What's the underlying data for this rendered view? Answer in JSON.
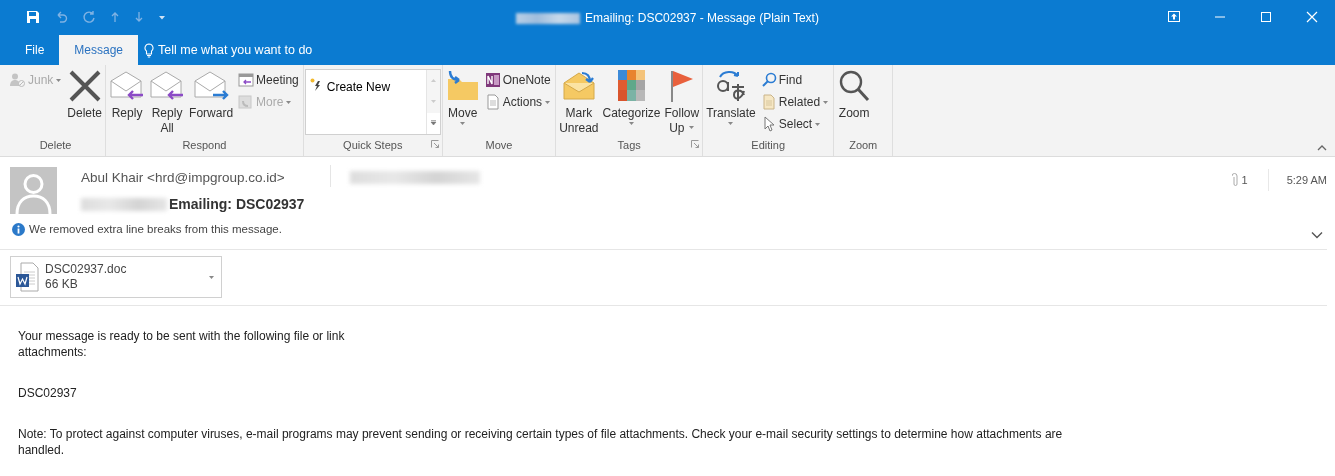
{
  "window": {
    "title": "Emailing: DSC02937 - Message (Plain Text)"
  },
  "tabs": [
    {
      "label": "File",
      "selected": false
    },
    {
      "label": "Message",
      "selected": true
    }
  ],
  "tell_me": {
    "placeholder": "Tell me what you want to do"
  },
  "ribbon": {
    "groups": [
      {
        "label": "Delete",
        "launcher": false,
        "items": [
          {
            "kind": "stack",
            "items": [
              {
                "label": "Junk",
                "disabled": true,
                "dropdown": true
              }
            ]
          },
          {
            "kind": "large",
            "lines": [
              "Delete"
            ],
            "dropdown": false
          }
        ]
      },
      {
        "label": "Respond",
        "launcher": false,
        "items": [
          {
            "kind": "large",
            "lines": [
              "Reply"
            ],
            "dropdown": false
          },
          {
            "kind": "large",
            "lines": [
              "Reply",
              "All"
            ],
            "dropdown": false
          },
          {
            "kind": "large",
            "lines": [
              "Forward"
            ],
            "dropdown": false
          },
          {
            "kind": "stack",
            "items": [
              {
                "label": "Meeting",
                "disabled": false,
                "dropdown": false
              },
              {
                "label": "More",
                "disabled": true,
                "dropdown": true
              }
            ]
          }
        ]
      },
      {
        "label": "Quick Steps",
        "launcher": true,
        "items": [
          {
            "kind": "gallery",
            "entry": "Create New"
          }
        ]
      },
      {
        "label": "Move",
        "launcher": false,
        "items": [
          {
            "kind": "large",
            "lines": [
              "Move"
            ],
            "dropdown": true
          },
          {
            "kind": "stack",
            "items": [
              {
                "label": "OneNote",
                "disabled": false,
                "dropdown": false
              },
              {
                "label": "Actions",
                "disabled": false,
                "dropdown": true
              }
            ]
          }
        ]
      },
      {
        "label": "Tags",
        "launcher": true,
        "items": [
          {
            "kind": "large",
            "lines": [
              "Mark",
              "Unread"
            ],
            "dropdown": false
          },
          {
            "kind": "large",
            "lines": [
              "Categorize"
            ],
            "dropdown": true
          },
          {
            "kind": "large",
            "lines": [
              "Follow",
              "Up"
            ],
            "dropdown": true
          }
        ]
      },
      {
        "label": "Editing",
        "launcher": false,
        "items": [
          {
            "kind": "large",
            "lines": [
              "Translate"
            ],
            "dropdown": true
          },
          {
            "kind": "stack",
            "items": [
              {
                "label": "Find",
                "disabled": false,
                "dropdown": false
              },
              {
                "label": "Related",
                "disabled": false,
                "dropdown": true
              },
              {
                "label": "Select",
                "disabled": false,
                "dropdown": true
              }
            ]
          }
        ]
      },
      {
        "label": "Zoom",
        "launcher": false,
        "items": [
          {
            "kind": "large",
            "lines": [
              "Zoom"
            ],
            "dropdown": false
          }
        ]
      }
    ]
  },
  "message": {
    "sender": "Abul Khair <hrd@impgroup.co.id>",
    "subject": "Emailing: DSC02937",
    "info": "We removed extra line breaks from this message.",
    "attachment_count": "1",
    "time": "5:29 AM"
  },
  "attachments": [
    {
      "name": "DSC02937.doc",
      "size": "66 KB"
    }
  ],
  "body": [
    "Your message is ready to be sent with the following file or link\nattachments:",
    "DSC02937",
    "Note: To protect against computer viruses, e-mail programs may prevent sending or receiving certain types of file attachments.  Check your e-mail security settings to determine how attachments are\nhandled."
  ]
}
